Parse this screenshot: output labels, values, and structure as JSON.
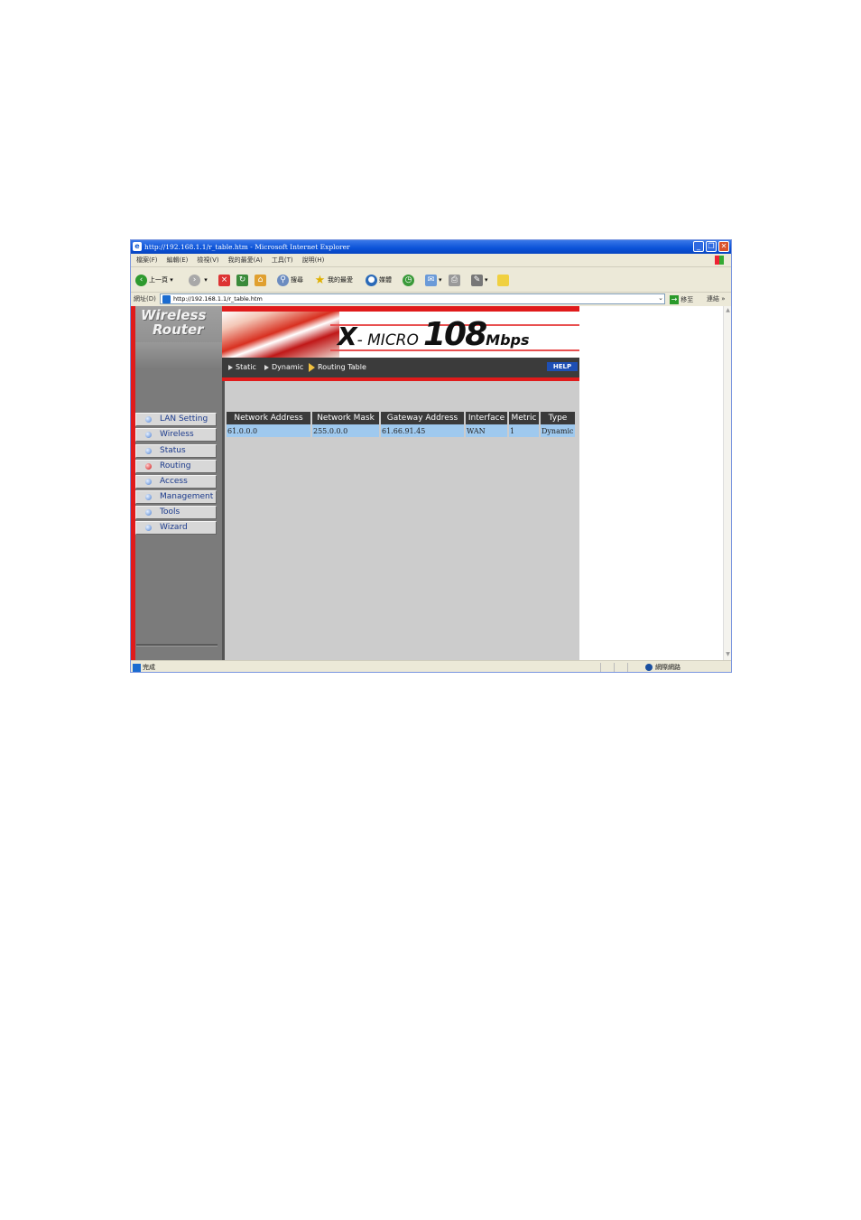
{
  "window": {
    "title": "http://192.168.1.1/r_table.htm - Microsoft Internet Explorer",
    "controls": {
      "minimize": "_",
      "restore": "❐",
      "close": "✕"
    }
  },
  "menubar": [
    "檔案(F)",
    "編輯(E)",
    "檢視(V)",
    "我的最愛(A)",
    "工具(T)",
    "說明(H)"
  ],
  "toolbar": {
    "back": "上一頁",
    "search": "搜尋",
    "favorites": "我的最愛",
    "media": "媒體"
  },
  "address": {
    "label": "網址(D)",
    "url": "http://192.168.1.1/r_table.htm",
    "go": "移至",
    "links": "連結"
  },
  "status": {
    "text": "完成",
    "zone": "網際網路"
  },
  "router": {
    "logo_line1": "Wireless",
    "logo_line2": "Router",
    "brand": {
      "x": "X",
      "micro": "- MICRO",
      "speed": "108",
      "unit": "Mbps"
    },
    "nav": [
      {
        "label": "LAN Setting",
        "active": false
      },
      {
        "label": "Wireless",
        "active": false
      },
      {
        "label": "Status",
        "active": false
      },
      {
        "label": "Routing",
        "active": true
      },
      {
        "label": "Access",
        "active": false
      },
      {
        "label": "Management",
        "active": false
      },
      {
        "label": "Tools",
        "active": false
      },
      {
        "label": "Wizard",
        "active": false
      }
    ],
    "subnav": [
      "Static",
      "Dynamic",
      "Routing Table"
    ],
    "help": "HELP",
    "table": {
      "headers": [
        "Network Address",
        "Network Mask",
        "Gateway Address",
        "Interface",
        "Metric",
        "Type"
      ],
      "rows": [
        [
          "61.0.0.0",
          "255.0.0.0",
          "61.66.91.45",
          "WAN",
          "1",
          "Dynamic"
        ]
      ]
    }
  },
  "colors": {
    "accent_red": "#e01b1b",
    "nav_text": "#1b3a8c",
    "table_header": "#3a3a3a",
    "table_row": "#9fc9ee"
  }
}
